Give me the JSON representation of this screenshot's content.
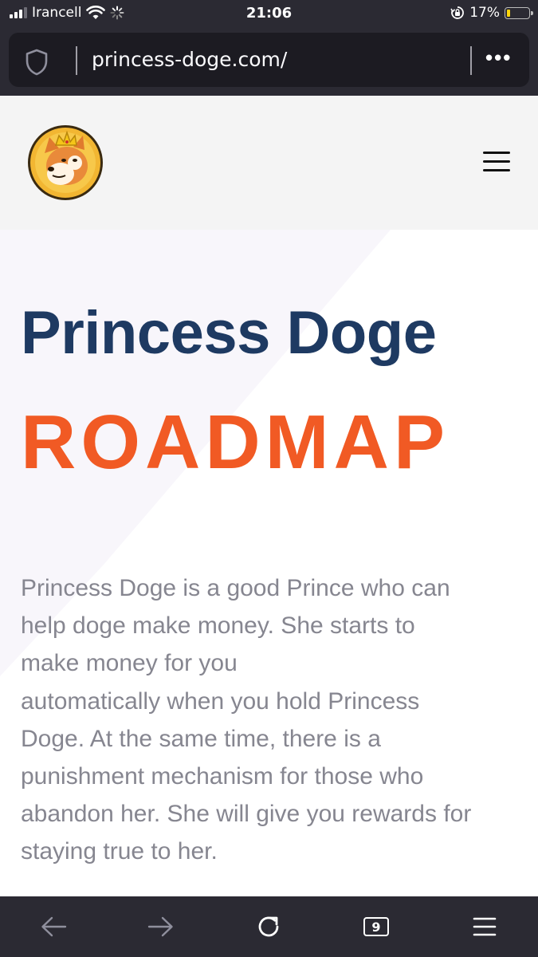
{
  "status_bar": {
    "carrier": "Irancell",
    "time": "21:06",
    "battery": "17%",
    "battery_level": 0.17,
    "icons": [
      "signal-icon",
      "wifi-icon",
      "loading-icon",
      "orientation-lock-icon",
      "battery-icon"
    ]
  },
  "browser": {
    "url": "princess-doge.com/",
    "icons": [
      "shield-icon",
      "more-icon"
    ],
    "toolbar": {
      "tab_count": "9",
      "icons": [
        "back-arrow-icon",
        "forward-arrow-icon",
        "reload-icon",
        "tabs-icon",
        "menu-icon"
      ]
    }
  },
  "site": {
    "logo_icon": "princess-doge-logo-icon",
    "menu_icon": "hamburger-icon",
    "title": "Princess Doge",
    "subtitle": "ROADMAP",
    "description_lines": [
      "Princess Doge is a good Prince who can",
      "help doge make money. She starts to",
      "make money for you",
      "automatically when you hold Princess",
      "Doge. At the same time, there is a",
      "punishment mechanism for those who",
      "abandon her. She will give you rewards for",
      "staying true to her."
    ]
  },
  "colors": {
    "chrome_bg": "#2b2a33",
    "url_field_bg": "#1c1b22",
    "header_bg": "#f4f4f4",
    "title": "#1e3a62",
    "accent": "#f15a24",
    "body_text": "#868690"
  }
}
